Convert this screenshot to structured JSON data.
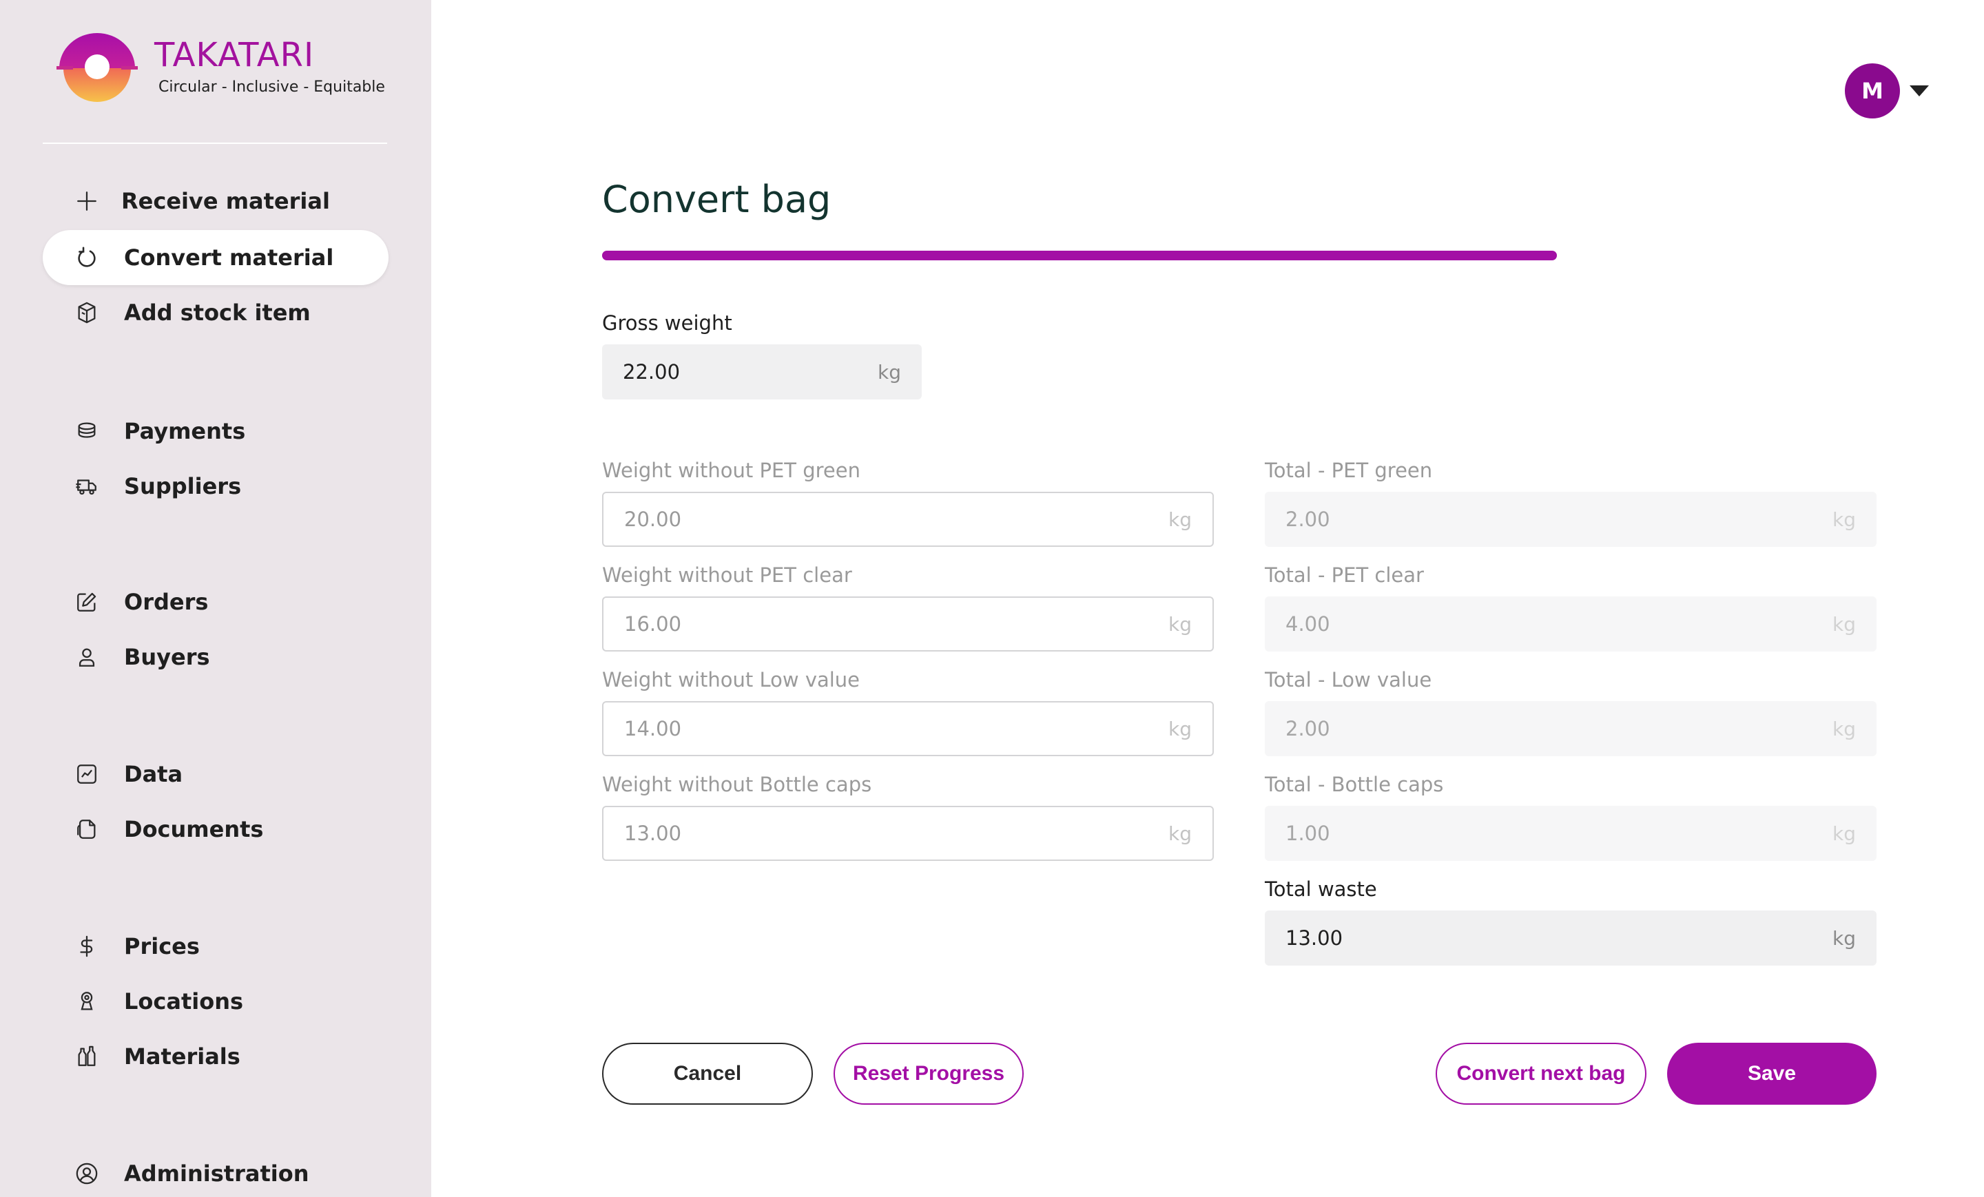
{
  "brand": {
    "name": "TAKATARI",
    "tagline": "Circular - Inclusive - Equitable"
  },
  "sidebar": {
    "items": [
      {
        "label": "Receive material",
        "icon": "plus-icon"
      },
      {
        "label": "Convert material",
        "icon": "rotate-icon",
        "active": true
      },
      {
        "label": "Add stock item",
        "icon": "package-icon"
      },
      {
        "label": "Payments",
        "icon": "coins-icon"
      },
      {
        "label": "Suppliers",
        "icon": "truck-icon"
      },
      {
        "label": "Orders",
        "icon": "edit-icon"
      },
      {
        "label": "Buyers",
        "icon": "user-icon"
      },
      {
        "label": "Data",
        "icon": "chart-icon"
      },
      {
        "label": "Documents",
        "icon": "documents-icon"
      },
      {
        "label": "Prices",
        "icon": "dollar-icon"
      },
      {
        "label": "Locations",
        "icon": "location-icon"
      },
      {
        "label": "Materials",
        "icon": "bottles-icon"
      },
      {
        "label": "Administration",
        "icon": "user-circle-icon"
      }
    ]
  },
  "header": {
    "avatar_initial": "M"
  },
  "main": {
    "title": "Convert bag",
    "progress_percent": 100,
    "gross_weight": {
      "label": "Gross weight",
      "value": "22.00",
      "unit": "kg"
    },
    "weights_without": [
      {
        "label": "Weight without PET green",
        "value": "20.00",
        "unit": "kg"
      },
      {
        "label": "Weight without PET clear",
        "value": "16.00",
        "unit": "kg"
      },
      {
        "label": "Weight without Low value",
        "value": "14.00",
        "unit": "kg"
      },
      {
        "label": "Weight without Bottle caps",
        "value": "13.00",
        "unit": "kg"
      }
    ],
    "totals": [
      {
        "label": "Total - PET green",
        "value": "2.00",
        "unit": "kg"
      },
      {
        "label": "Total - PET clear",
        "value": "4.00",
        "unit": "kg"
      },
      {
        "label": "Total - Low value",
        "value": "2.00",
        "unit": "kg"
      },
      {
        "label": "Total - Bottle caps",
        "value": "1.00",
        "unit": "kg"
      }
    ],
    "total_waste": {
      "label": "Total waste",
      "value": "13.00",
      "unit": "kg"
    }
  },
  "actions": {
    "cancel": "Cancel",
    "reset": "Reset Progress",
    "convert_next": "Convert next bag",
    "save": "Save"
  },
  "colors": {
    "brand": "#a30fa5",
    "sidebar_bg": "#ebe5e9",
    "title": "#13342f",
    "avatar": "#8a0a8e"
  }
}
